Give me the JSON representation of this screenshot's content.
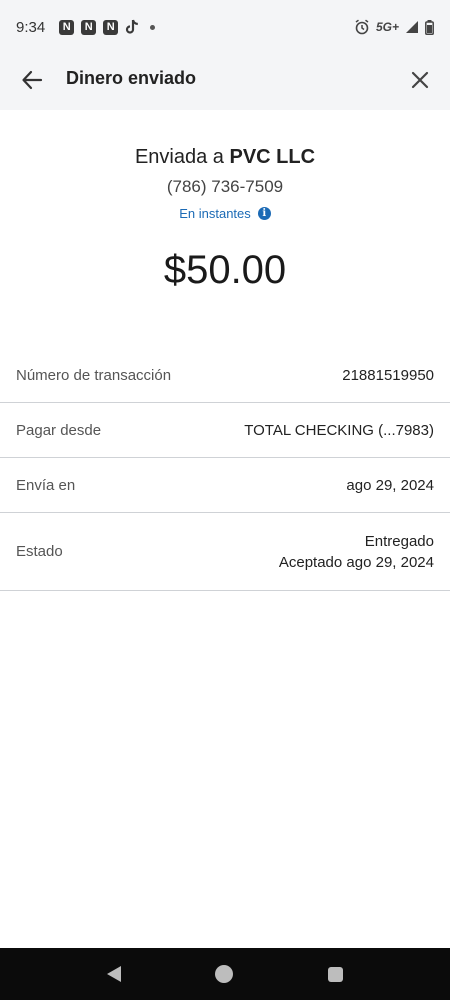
{
  "status_bar": {
    "time": "9:34",
    "network": "5G+",
    "notification_icons": [
      "N",
      "N",
      "N"
    ]
  },
  "header": {
    "title": "Dinero enviado",
    "back_icon": "arrow-left-icon",
    "close_icon": "close-icon"
  },
  "summary": {
    "sent_prefix": "Enviada a",
    "recipient_name": "PVC LLC",
    "recipient_phone": "(786) 736-7509",
    "speed_text": "En instantes",
    "amount": "$50.00"
  },
  "details": [
    {
      "label": "Número de transacción",
      "value": "21881519950"
    },
    {
      "label": "Pagar desde",
      "value": "TOTAL CHECKING (...7983)"
    },
    {
      "label": "Envía en",
      "value": "ago 29, 2024"
    },
    {
      "label": "Estado",
      "value": "Entregado",
      "value2": "Aceptado ago 29, 2024"
    }
  ],
  "colors": {
    "accent": "#1b6ab5",
    "header_bg": "#f4f5f7",
    "divider": "#cfd2d6"
  }
}
